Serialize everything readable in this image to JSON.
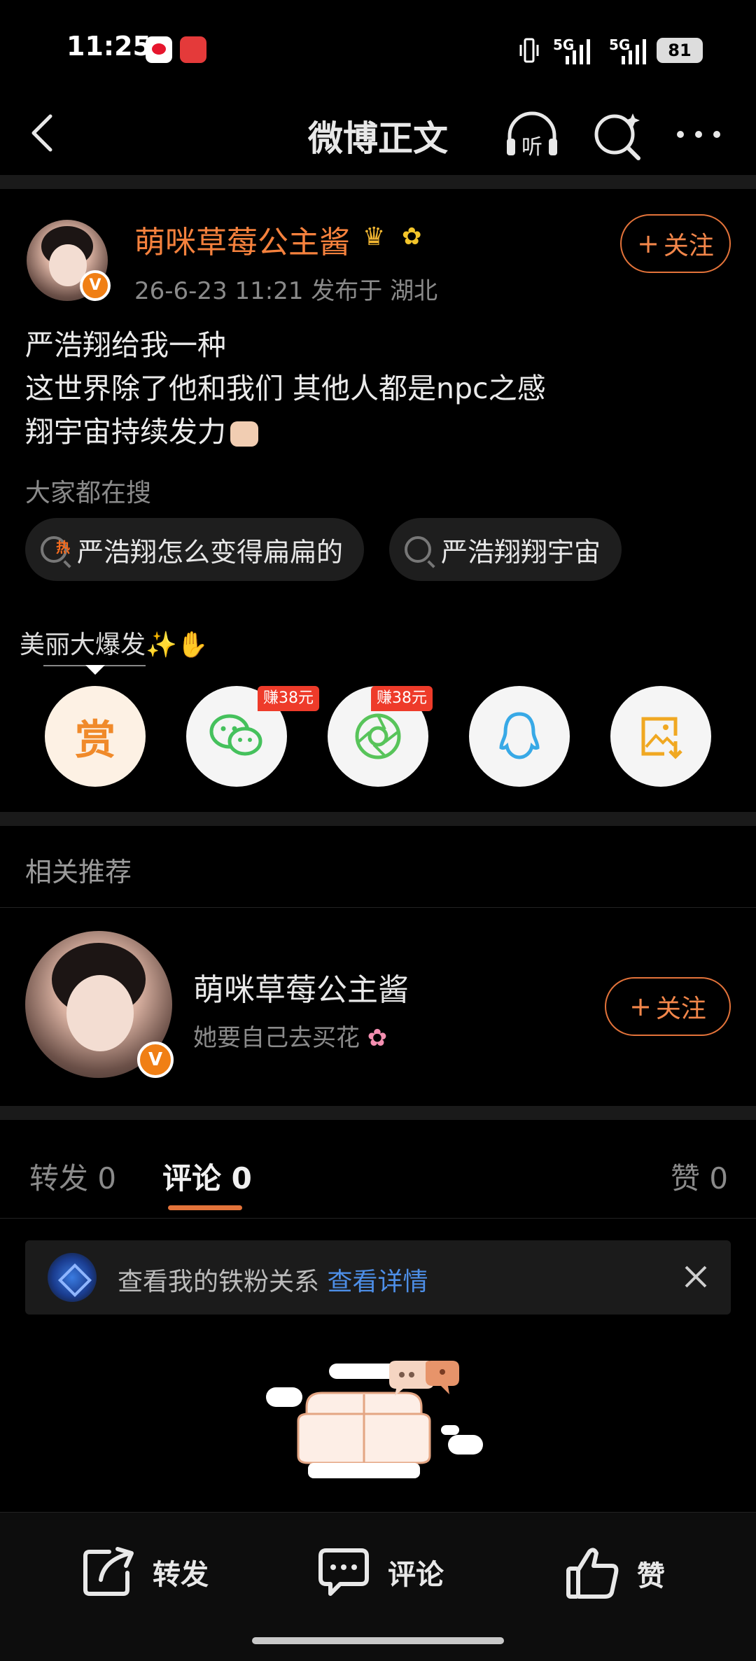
{
  "status_bar": {
    "time": "11:25",
    "signal1": "5G",
    "signal2": "5G",
    "battery": "81"
  },
  "header": {
    "title": "微博正文",
    "listen_label": "听"
  },
  "post": {
    "author": "萌咪草莓公主酱",
    "meta": "26-6-23 11:21   发布于 湖北",
    "follow_label": "关注",
    "lines": [
      "严浩翔给我一种",
      "这世界除了他和我们 其他人都是npc之感",
      "翔宇宙持续发力"
    ],
    "verified_mark": "V"
  },
  "search": {
    "label": "大家都在搜",
    "hot_tag": "热",
    "chips": [
      "严浩翔怎么变得扁扁的",
      "严浩翔翔宇宙"
    ]
  },
  "share": {
    "label": "美丽大爆发✨",
    "reward_char": "赏",
    "earn_badge_1": "赚38元",
    "earn_badge_2": "赚38元"
  },
  "recommend": {
    "title": "相关推荐",
    "name": "萌咪草莓公主酱",
    "bio": "她要自己去买花",
    "follow_label": "关注"
  },
  "tabs": {
    "repost": "转发 0",
    "comment": "评论 0",
    "like": "赞 0"
  },
  "fan_bar": {
    "text": "查看我的铁粉关系 ",
    "link": "查看详情"
  },
  "bottom": {
    "repost": "转发",
    "comment": "评论",
    "like": "赞"
  },
  "colors": {
    "accent": "#f5813d",
    "background": "#000000",
    "link": "#4d8ee6"
  }
}
